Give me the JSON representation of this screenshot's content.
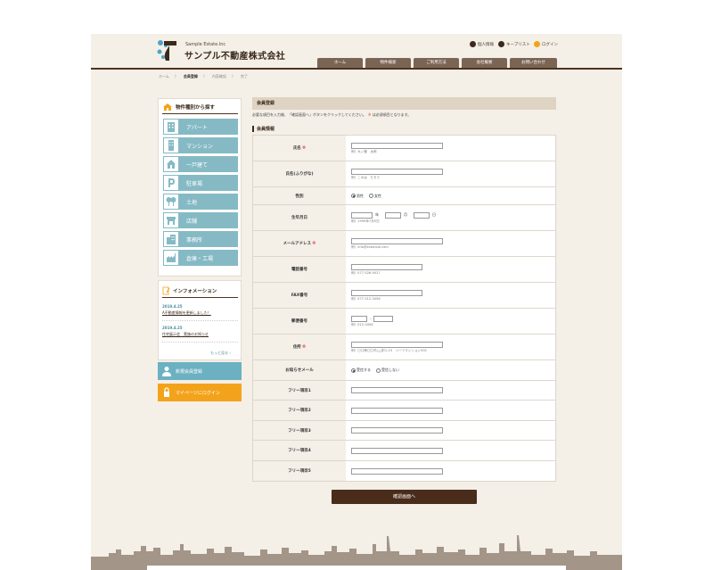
{
  "header": {
    "brand_en": "Sample Estate.Inc",
    "brand_ja": "サンプル不動産株式会社",
    "links": [
      {
        "label": "個人情報"
      },
      {
        "label": "キープリスト"
      },
      {
        "label": "ログイン"
      }
    ],
    "tabs": [
      {
        "label": "ホーム"
      },
      {
        "label": "物件検索"
      },
      {
        "label": "ご利用方法"
      },
      {
        "label": "会社概要"
      },
      {
        "label": "お問い合わせ"
      }
    ]
  },
  "breadcrumb": [
    "ホーム",
    "会員登録",
    "内容確認",
    "完了"
  ],
  "sidebar": {
    "category_title": "物件種別から探す",
    "categories": [
      {
        "label": "アパート"
      },
      {
        "label": "マンション"
      },
      {
        "label": "一戸建て"
      },
      {
        "label": "駐車場"
      },
      {
        "label": "土地"
      },
      {
        "label": "店舗"
      },
      {
        "label": "事務所"
      },
      {
        "label": "倉庫・工場"
      }
    ],
    "info_title": "インフォメーション",
    "news": [
      {
        "date": "2019.4.25",
        "text": "A不動産情報を更新しました！"
      },
      {
        "date": "2019.4.25",
        "text": "住宅展示会　実施のお知らせ"
      }
    ],
    "more": "もっと見る",
    "register": "新規会員登録",
    "login": "マイページにログイン"
  },
  "main": {
    "title": "会員登録",
    "desc": "必要な項目を入力後、「確認画面へ」ボタンをクリックしてください。",
    "req_mark": "※",
    "req_note": "は必須項目となります。",
    "section": "会員情報",
    "fields": {
      "name": {
        "label": "氏名",
        "ex": "例）大ノ菅　太郎"
      },
      "kana": {
        "label": "氏名(ふりがな)",
        "ex": "例）このは　たろう"
      },
      "gender": {
        "label": "性別",
        "opt1": "男性",
        "opt2": "女性"
      },
      "birth": {
        "label": "生年月日",
        "y": "年",
        "m": "月",
        "d": "日",
        "ex": "例）1999年7月5日"
      },
      "email": {
        "label": "メールアドレス",
        "ex": "例）info@example.com"
      },
      "tel": {
        "label": "電話番号",
        "ex": "例）077-526-9027"
      },
      "fax": {
        "label": "FAX番号",
        "ex": "例）077-512-3456"
      },
      "zip": {
        "label": "郵便番号",
        "sep": "-",
        "ex": "例）012-3456"
      },
      "addr": {
        "label": "住所",
        "ex": "例）〇〇県〇〇市△△町1-23　リーフマンション501"
      },
      "mail": {
        "label": "お知らせメール",
        "opt1": "受信する",
        "opt2": "受信しない"
      },
      "free1": {
        "label": "フリー項目1"
      },
      "free2": {
        "label": "フリー項目2"
      },
      "free3": {
        "label": "フリー項目3"
      },
      "free4": {
        "label": "フリー項目4"
      },
      "free5": {
        "label": "フリー項目5"
      }
    },
    "confirm": "確認画面へ"
  }
}
